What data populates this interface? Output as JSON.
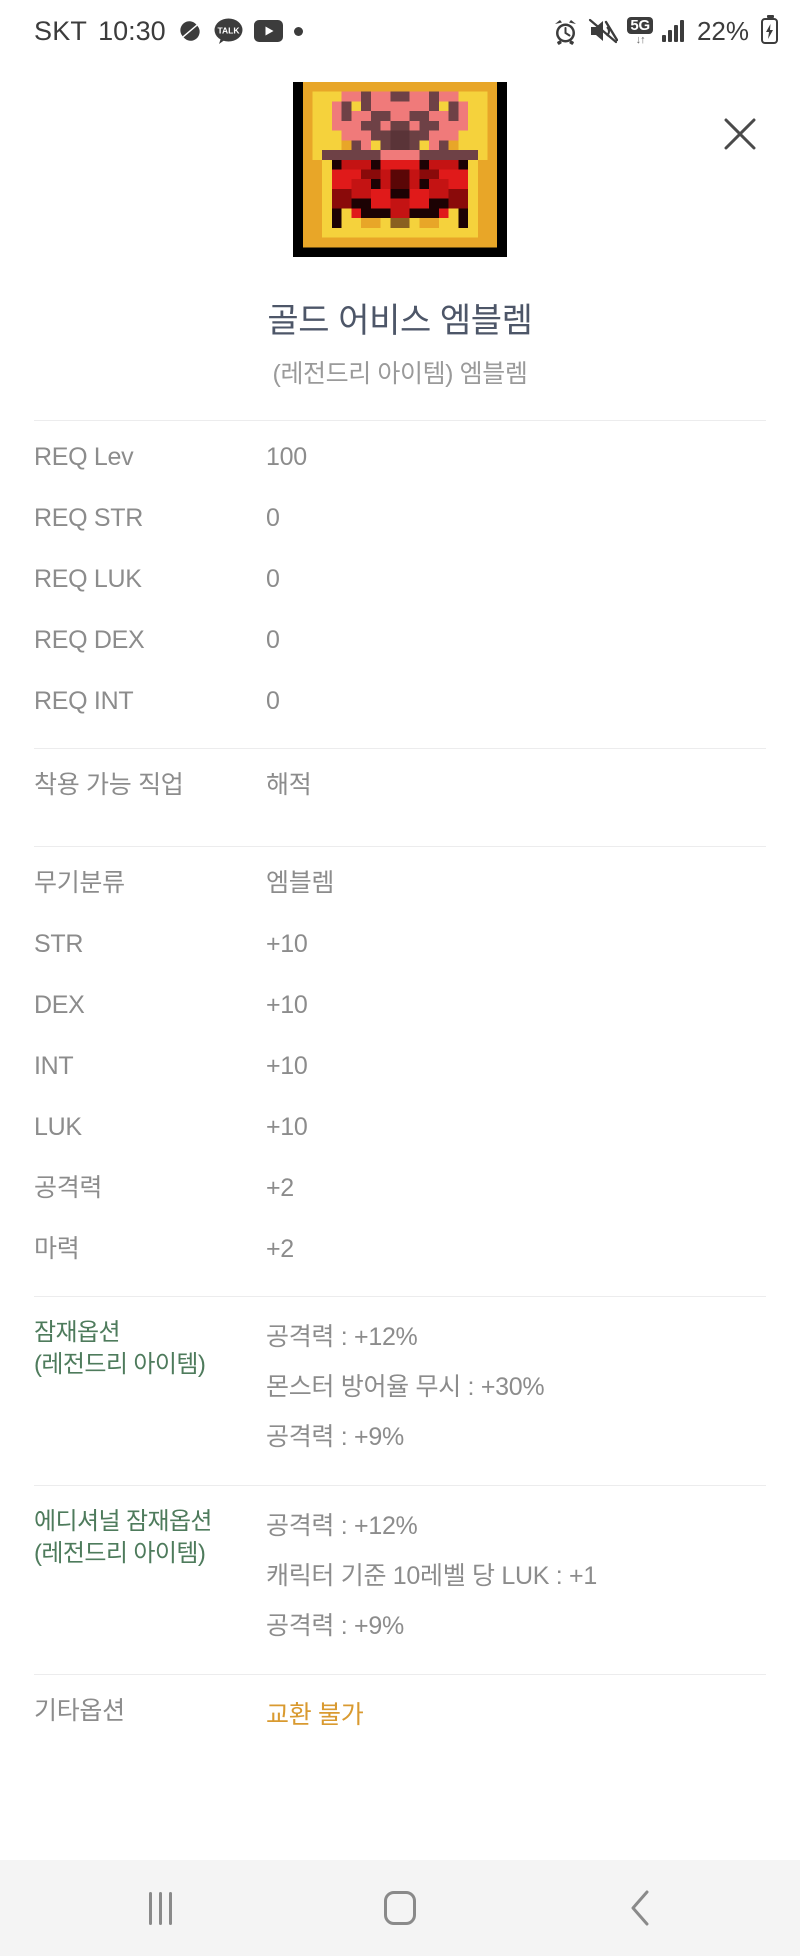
{
  "status_bar": {
    "carrier": "SKT",
    "time": "10:30",
    "icons_left": [
      "pill-icon",
      "kakaotalk-icon",
      "youtube-icon",
      "dot-icon"
    ],
    "talk_label": "TALK",
    "network": "5G",
    "network_arrows": "↓↑",
    "battery_percent": "22%",
    "icons_right": [
      "alarm-icon",
      "mute-icon",
      "network-5g-icon",
      "signal-bars-icon",
      "battery-icon"
    ]
  },
  "header": {
    "close_label": "✕"
  },
  "item": {
    "title": "골드 어비스 엠블렘",
    "subtitle": "(레전드리 아이템) 엠블렘"
  },
  "requirements": [
    {
      "label": "REQ Lev",
      "value": "100"
    },
    {
      "label": "REQ STR",
      "value": "0"
    },
    {
      "label": "REQ LUK",
      "value": "0"
    },
    {
      "label": "REQ DEX",
      "value": "0"
    },
    {
      "label": "REQ INT",
      "value": "0"
    }
  ],
  "job": {
    "label": "착용 가능 직업",
    "value": "해적"
  },
  "stats": [
    {
      "label": "무기분류",
      "value": "엠블렘"
    },
    {
      "label": "STR",
      "value": "+10"
    },
    {
      "label": "DEX",
      "value": "+10"
    },
    {
      "label": "INT",
      "value": "+10"
    },
    {
      "label": "LUK",
      "value": "+10"
    },
    {
      "label": "공격력",
      "value": "+2"
    },
    {
      "label": "마력",
      "value": "+2"
    }
  ],
  "potential": {
    "label_line1": "잠재옵션",
    "label_line2": "(레전드리 아이템)",
    "options": [
      "공격력 : +12%",
      "몬스터 방어율 무시 : +30%",
      "공격력 : +9%"
    ]
  },
  "additional_potential": {
    "label_line1": "에디셔널 잠재옵션",
    "label_line2": "(레전드리 아이템)",
    "options": [
      "공격력 : +12%",
      "캐릭터 기준 10레벨 당 LUK : +1",
      "공격력 : +9%"
    ]
  },
  "etc": {
    "label": "기타옵션",
    "value": "교환 불가"
  },
  "navbar": {
    "recents_label": "recents",
    "home_label": "home",
    "back_label": "back"
  },
  "colors": {
    "title": "#4d5668",
    "muted": "#8c8c8c",
    "potential_green": "#4e7b5c",
    "etc_orange": "#d99a30",
    "divider": "#ececed",
    "navbar_bg": "#f4f4f4"
  }
}
